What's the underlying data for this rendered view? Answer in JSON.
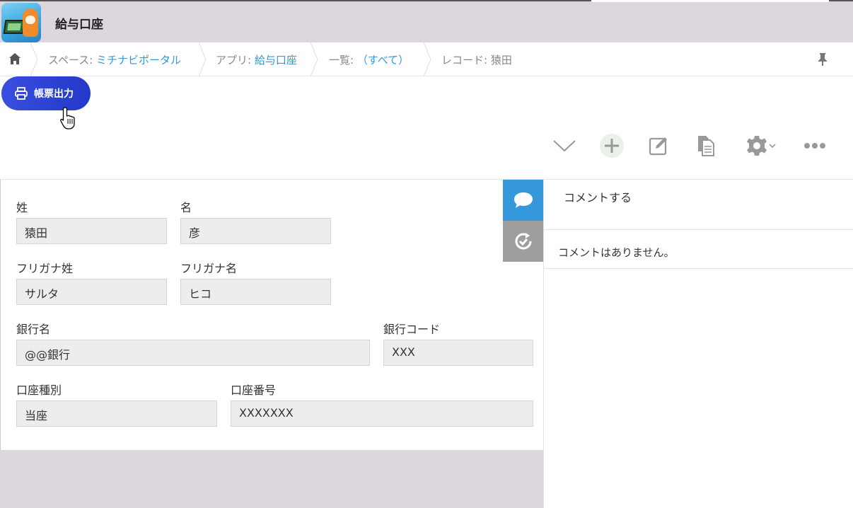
{
  "app": {
    "title": "給与口座"
  },
  "breadcrumb": {
    "space_prefix": "スペース: ",
    "space_link": "ミチナビポータル",
    "app_prefix": "アプリ: ",
    "app_link": "給与口座",
    "list_prefix": "一覧: ",
    "list_link": "（すべて）",
    "record_label": "レコード: 猿田"
  },
  "plugin": {
    "print_label": "帳票出力"
  },
  "toolbar": {
    "icons": [
      "chevron-down-icon",
      "add-record-icon",
      "edit-icon",
      "duplicate-icon",
      "gear-icon",
      "more-icon"
    ]
  },
  "form": {
    "last_name_label": "姓",
    "last_name_value": "猿田",
    "first_name_label": "名",
    "first_name_value": "彦",
    "kana_last_label": "フリガナ姓",
    "kana_last_value": "サルタ",
    "kana_first_label": "フリガナ名",
    "kana_first_value": "ヒコ",
    "bank_name_label": "銀行名",
    "bank_name_value": "@@銀行",
    "bank_code_label": "銀行コード",
    "bank_code_value": "XXX",
    "account_type_label": "口座種別",
    "account_type_value": "当座",
    "account_number_label": "口座番号",
    "account_number_value": "XXXXXXX"
  },
  "comments": {
    "post_label": "コメントする",
    "empty_message": "コメントはありません。"
  },
  "colors": {
    "header_bg": "#ddd6de",
    "link": "#3498db",
    "print_button": "#2a40d4",
    "comment_tab": "#3498db",
    "history_tab": "#9e9e9e"
  }
}
